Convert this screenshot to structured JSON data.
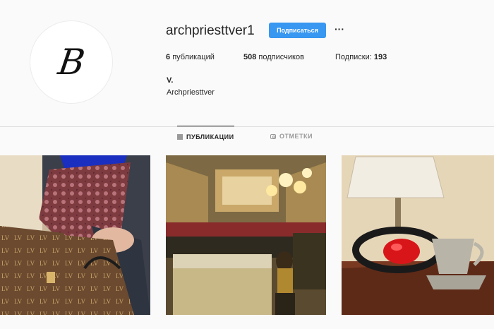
{
  "profile": {
    "avatar_letter": "B",
    "username": "archpriesttver1",
    "follow_label": "Подписаться",
    "more_label": "···",
    "posts_count": "6",
    "posts_label": "публикаций",
    "followers_count": "508",
    "followers_label": "подписчиков",
    "following_label": "Подписки:",
    "following_count": "193",
    "full_name": "V.",
    "bio": "Archpriesttver"
  },
  "tabs": [
    {
      "label": "ПУБЛИКАЦИИ",
      "icon": "grid-icon",
      "active": true
    },
    {
      "label": "ОТМЕТКИ",
      "icon": "tag-icon",
      "active": false
    }
  ],
  "colors": {
    "accent": "#3897f0",
    "background": "#fafafa",
    "text": "#262626"
  }
}
